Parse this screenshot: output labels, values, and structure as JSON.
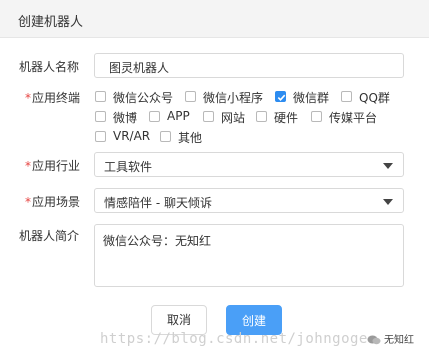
{
  "dialog": {
    "title": "创建机器人",
    "name_label": "机器人名称",
    "name_value": "图灵机器人",
    "platform_label": "应用终端",
    "required_mark": "*",
    "platforms": [
      {
        "label": "微信公众号",
        "checked": false
      },
      {
        "label": "微信小程序",
        "checked": false
      },
      {
        "label": "微信群",
        "checked": true
      },
      {
        "label": "QQ群",
        "checked": false
      },
      {
        "label": "微博",
        "checked": false
      },
      {
        "label": "APP",
        "checked": false
      },
      {
        "label": "网站",
        "checked": false
      },
      {
        "label": "硬件",
        "checked": false
      },
      {
        "label": "传媒平台",
        "checked": false
      },
      {
        "label": "VR/AR",
        "checked": false
      },
      {
        "label": "其他",
        "checked": false
      }
    ],
    "industry_label": "应用行业",
    "industry_value": "工具软件",
    "scene_label": "应用场景",
    "scene_value": "情感陪伴 - 聊天倾诉",
    "intro_label": "机器人简介",
    "intro_value": "微信公众号：无知红",
    "cancel_label": "取消",
    "create_label": "创建"
  },
  "watermark": {
    "url": "https://blog.csdn.net/johngoge",
    "badge": "无知红"
  },
  "colors": {
    "accent": "#4a9ff7",
    "checkbox_checked": "#2d8cf0",
    "required": "#e64340",
    "header_bg": "#f4f4f4"
  }
}
